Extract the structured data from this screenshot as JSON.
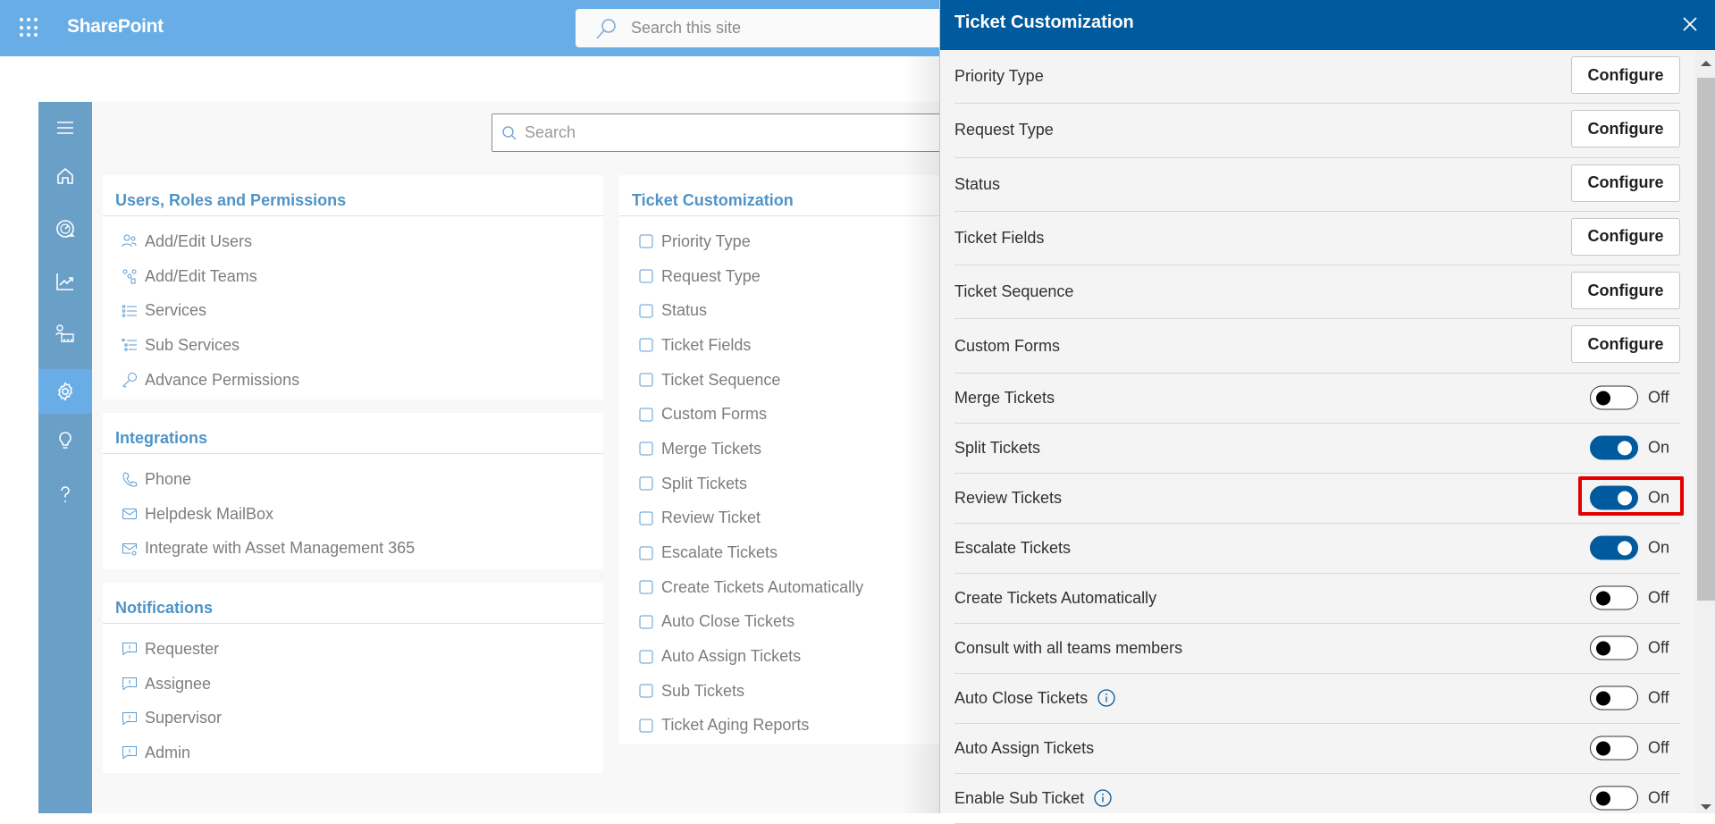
{
  "topbar": {
    "app_name": "SharePoint",
    "search_placeholder": "Search this site"
  },
  "sidebar": {
    "items": [
      {
        "name": "menu",
        "icon": "hamburger-icon"
      },
      {
        "name": "home",
        "icon": "home-icon"
      },
      {
        "name": "dashboard",
        "icon": "speedometer-icon"
      },
      {
        "name": "reports",
        "icon": "chart-line-icon"
      },
      {
        "name": "teams",
        "icon": "people-board-icon"
      },
      {
        "name": "settings",
        "icon": "gear-icon",
        "active": true
      },
      {
        "name": "ideas",
        "icon": "lightbulb-icon"
      },
      {
        "name": "help",
        "icon": "question-icon"
      }
    ]
  },
  "content": {
    "search_placeholder": "Search",
    "cards": {
      "users": {
        "title": "Users, Roles and Permissions",
        "items": [
          "Add/Edit Users",
          "Add/Edit Teams",
          "Services",
          "Sub Services",
          "Advance Permissions"
        ]
      },
      "integrations": {
        "title": "Integrations",
        "items": [
          "Phone",
          "Helpdesk MailBox",
          "Integrate with Asset Management 365"
        ]
      },
      "notifications": {
        "title": "Notifications",
        "items": [
          "Requester",
          "Assignee",
          "Supervisor",
          "Admin"
        ]
      },
      "ticket": {
        "title": "Ticket Customization",
        "items": [
          "Priority Type",
          "Request Type",
          "Status",
          "Ticket Fields",
          "Ticket Sequence",
          "Custom Forms",
          "Merge Tickets",
          "Split Tickets",
          "Review Ticket",
          "Escalate Tickets",
          "Create Tickets Automatically",
          "Auto Close Tickets",
          "Auto Assign Tickets",
          "Sub Tickets",
          "Ticket Aging Reports"
        ]
      }
    }
  },
  "panel": {
    "title": "Ticket Customization",
    "configure_label": "Configure",
    "on_label": "On",
    "off_label": "Off",
    "configure_rows": [
      "Priority Type",
      "Request Type",
      "Status",
      "Ticket Fields",
      "Ticket Sequence",
      "Custom Forms"
    ],
    "toggle_rows": [
      {
        "label": "Merge Tickets",
        "on": false,
        "info": false
      },
      {
        "label": "Split Tickets",
        "on": true,
        "info": false
      },
      {
        "label": "Review Tickets",
        "on": true,
        "info": false,
        "highlighted": true
      },
      {
        "label": "Escalate Tickets",
        "on": true,
        "info": false
      },
      {
        "label": "Create Tickets Automatically",
        "on": false,
        "info": false
      },
      {
        "label": "Consult with all teams members",
        "on": false,
        "info": false
      },
      {
        "label": "Auto Close Tickets",
        "on": false,
        "info": true
      },
      {
        "label": "Auto Assign Tickets",
        "on": false,
        "info": false
      },
      {
        "label": "Enable Sub Ticket",
        "on": false,
        "info": true
      }
    ],
    "toggle_states": {
      "merge_tickets": "Off",
      "split_tickets": "On",
      "review_tickets": "On",
      "escalate_tickets": "On",
      "create_tickets_automatically": "Off",
      "consult_with_all_teams_members": "Off",
      "auto_close_tickets": "Off",
      "auto_assign_tickets": "Off",
      "enable_sub_ticket": "Off"
    }
  },
  "colors": {
    "topbar": "#68ade5",
    "sidebar": "#6a9fc8",
    "panel_header": "#005a9e",
    "toggle_on": "#005a9e",
    "card_title": "#4f94c7",
    "highlight": "#e50000"
  }
}
